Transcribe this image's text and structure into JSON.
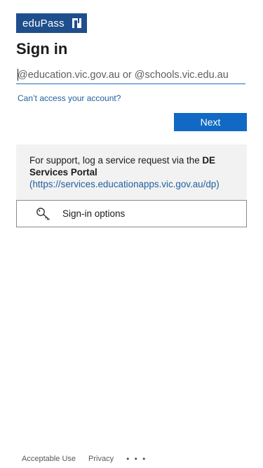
{
  "brand": {
    "logo_text": "eduPass",
    "color": "#1f4e8c"
  },
  "title": "Sign in",
  "email": {
    "value": "",
    "placeholder": "@education.vic.gov.au or @schools.vic.edu.au"
  },
  "links": {
    "cant_access": "Can’t access your account?"
  },
  "buttons": {
    "next": "Next",
    "next_color": "#1169c4"
  },
  "support": {
    "text_before": "For support, log a service request via the ",
    "portal_name": "DE Services Portal",
    "portal_link": "(https://services.educationapps.vic.gov.au/dp)"
  },
  "signin_options": {
    "icon": "key-icon",
    "label": "Sign-in options"
  },
  "footer": {
    "acceptable_use": "Acceptable Use",
    "privacy": "Privacy",
    "more": "• • •"
  }
}
